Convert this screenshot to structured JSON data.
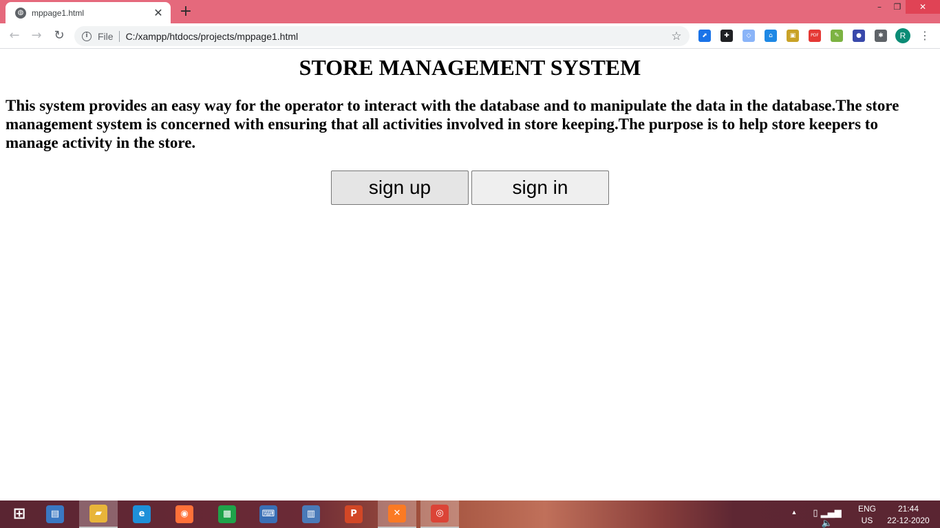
{
  "browser": {
    "tab": {
      "title": "mppage1.html",
      "favicon": "globe-icon",
      "close_glyph": "✕"
    },
    "new_tab_glyph": "+",
    "window_controls": {
      "minimize": "–",
      "maximize": "❐",
      "close": "✕"
    },
    "toolbar": {
      "back_glyph": "←",
      "forward_glyph": "→",
      "reload_glyph": "↻",
      "omnibox": {
        "info_glyph": "i",
        "scheme": "File",
        "url": "C:/xampp/htdocs/projects/mppage1.html",
        "star_glyph": "☆"
      },
      "extensions": [
        {
          "name": "extension-1-icon",
          "color": "#1a73e8",
          "glyph": "⬈"
        },
        {
          "name": "extension-2-icon",
          "color": "#202124",
          "glyph": "✚"
        },
        {
          "name": "extension-3-icon",
          "color": "#8ab4f8",
          "glyph": "◇"
        },
        {
          "name": "extension-home-icon",
          "color": "#1e88e5",
          "glyph": "⌂"
        },
        {
          "name": "extension-5-icon",
          "color": "#c9a227",
          "glyph": "▣"
        },
        {
          "name": "extension-pdf-icon",
          "color": "#e53935",
          "glyph": "PDF"
        },
        {
          "name": "extension-7-icon",
          "color": "#7cb342",
          "glyph": "✎"
        },
        {
          "name": "extension-8-icon",
          "color": "#3949ab",
          "glyph": "●"
        },
        {
          "name": "extensions-puzzle-icon",
          "color": "#5f6368",
          "glyph": "✱"
        }
      ],
      "profile_initial": "R",
      "menu_glyph": "⋮"
    }
  },
  "page": {
    "title": "STORE MANAGEMENT SYSTEM",
    "description": "This system provides an easy way for the operator to interact with the database and to manipulate the data in the database.The store management system is concerned with ensuring that all activities involved in store keeping.The purpose is to help store keepers to manage activity in the store.",
    "buttons": {
      "sign_up": "sign up",
      "sign_in": "sign in"
    }
  },
  "taskbar": {
    "apps": [
      {
        "name": "start-button",
        "glyph": "⊞",
        "color": "#ffffff"
      },
      {
        "name": "taskbar-app-window",
        "glyph": "▤",
        "color": "#3a78c2"
      },
      {
        "name": "taskbar-app-file-explorer",
        "glyph": "▰",
        "color": "#e8b53a"
      },
      {
        "name": "taskbar-app-internet-explorer",
        "glyph": "e",
        "color": "#1e90d9"
      },
      {
        "name": "taskbar-app-firefox",
        "glyph": "◉",
        "color": "#ff7139"
      },
      {
        "name": "taskbar-app-store",
        "glyph": "▦",
        "color": "#1fa34a"
      },
      {
        "name": "taskbar-app-remote-desktop",
        "glyph": "⌨",
        "color": "#3a6fb5"
      },
      {
        "name": "taskbar-app-document",
        "glyph": "▥",
        "color": "#4a7ab8"
      },
      {
        "name": "taskbar-app-powerpoint",
        "glyph": "P",
        "color": "#d24726"
      },
      {
        "name": "taskbar-app-xampp",
        "glyph": "✕",
        "color": "#fb7a24"
      },
      {
        "name": "taskbar-app-chrome",
        "glyph": "◎",
        "color": "#db4437"
      }
    ],
    "tray": {
      "expand_glyph": "▲",
      "language": "ENG",
      "region": "US",
      "time": "21:44",
      "date": "22-12-2020"
    }
  }
}
